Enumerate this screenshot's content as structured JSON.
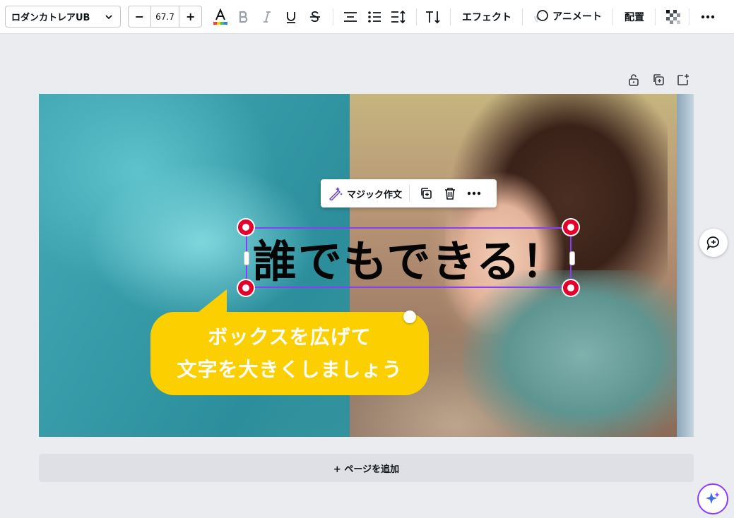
{
  "toolbar": {
    "font_name": "ロダンカトレアUB",
    "font_size": "67.7",
    "minus": "−",
    "plus": "+",
    "effects_label": "エフェクト",
    "animate_label": "アニメート",
    "position_label": "配置"
  },
  "floating_toolbar": {
    "magic_write_label": "マジック作文"
  },
  "design": {
    "headline": "誰でもできる！",
    "callout_line1": "ボックスを広げて",
    "callout_line2": "文字を大きくしましょう"
  },
  "add_page_label": "+ ページを追加",
  "colors": {
    "accent": "#8b3dff",
    "handle": "#e4002b",
    "callout": "#fcd000"
  }
}
